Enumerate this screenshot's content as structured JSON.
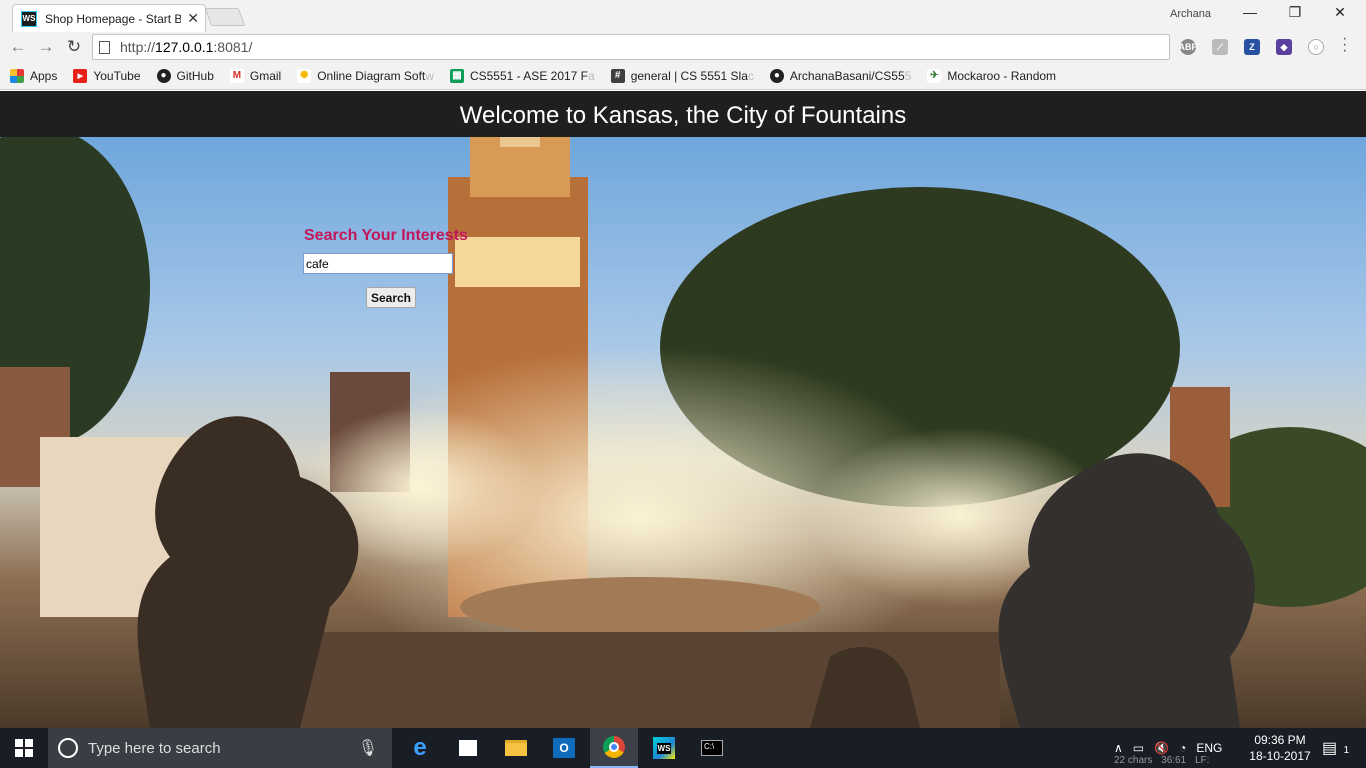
{
  "browser": {
    "tab_title": "Shop Homepage - Start B",
    "tab_icon": "WS",
    "user": "Archana",
    "url_prefix": "http://",
    "url_host": "127.0.0.1",
    "url_rest": ":8081/",
    "bookmarks": [
      {
        "label": "Apps",
        "icon": "apps-grid-icon",
        "truncated": ""
      },
      {
        "label": "YouTube",
        "icon": "youtube-icon",
        "truncated": ""
      },
      {
        "label": "GitHub",
        "icon": "github-icon",
        "truncated": ""
      },
      {
        "label": "Gmail",
        "icon": "gmail-icon",
        "truncated": ""
      },
      {
        "label": "Online Diagram Soft",
        "icon": "lightbulb-icon",
        "truncated": "w"
      },
      {
        "label": "CS5551 - ASE 2017 F",
        "icon": "sheets-icon",
        "truncated": "a"
      },
      {
        "label": "general | CS 5551 Sla",
        "icon": "slack-icon",
        "truncated": "c"
      },
      {
        "label": "ArchanaBasani/CS55",
        "icon": "github-icon",
        "truncated": "5"
      },
      {
        "label": "Mockaroo - Random",
        "icon": "mockaroo-icon",
        "truncated": ""
      }
    ]
  },
  "page": {
    "header_title": "Welcome to Kansas, the City of Fountains",
    "search_heading": "Search Your Interests",
    "search_value": "cafe",
    "search_button": "Search",
    "heading_color": "#c2185b"
  },
  "taskbar": {
    "search_placeholder": "Type here to search",
    "language": "ENG",
    "time": "09:36 PM",
    "date": "18-10-2017",
    "notification_count": "1",
    "status_chars": "22 chars",
    "status_pos": "36:61",
    "status_lf": "LF:"
  }
}
